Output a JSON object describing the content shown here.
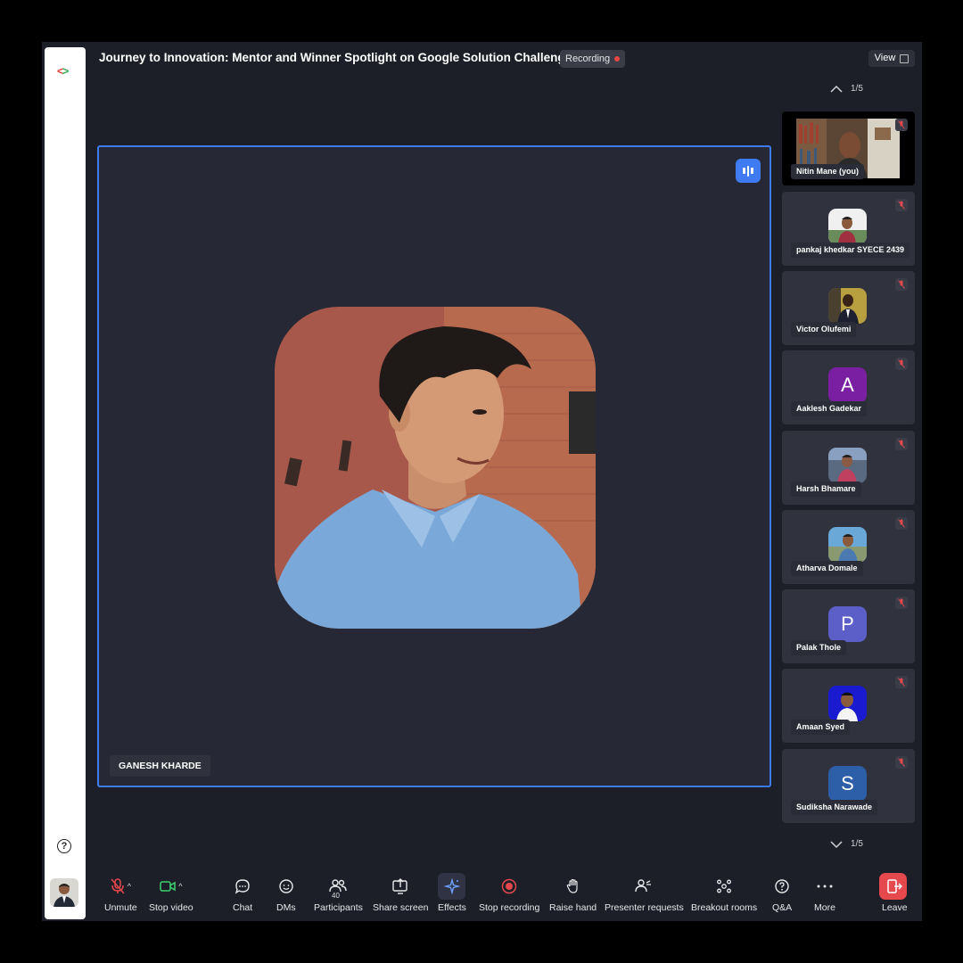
{
  "meeting": {
    "title": "Journey to Innovation: Mentor and Winner Spotlight on Google Solution Challenge",
    "recording_badge": "Recording",
    "view_label": "View",
    "page_top": "1/5",
    "page_bottom": "1/5"
  },
  "stage": {
    "speaker_name": "GANESH KHARDE"
  },
  "participants": [
    {
      "name": "Nitin Mane (you)",
      "type": "video"
    },
    {
      "name": "pankaj khedkar SYECE 2439",
      "type": "photo"
    },
    {
      "name": "Victor Olufemi",
      "type": "photo"
    },
    {
      "name": "Aaklesh Gadekar",
      "type": "letter",
      "letter": "A",
      "color": "#7b1fa2"
    },
    {
      "name": "Harsh Bhamare",
      "type": "photo"
    },
    {
      "name": "Atharva Domale",
      "type": "photo"
    },
    {
      "name": "Palak Thole",
      "type": "letter",
      "letter": "P",
      "color": "#5b5fc7"
    },
    {
      "name": "Amaan Syed",
      "type": "photo"
    },
    {
      "name": "Sudiksha Narawade",
      "type": "letter",
      "letter": "S",
      "color": "#2c5fa8"
    }
  ],
  "toolbar": {
    "unmute": "Unmute",
    "stop_video": "Stop video",
    "chat": "Chat",
    "dms": "DMs",
    "participants": "Participants",
    "participants_count": "40",
    "share_screen": "Share screen",
    "effects": "Effects",
    "stop_recording": "Stop recording",
    "raise_hand": "Raise hand",
    "presenter_requests": "Presenter requests",
    "breakout_rooms": "Breakout rooms",
    "qa": "Q&A",
    "more": "More",
    "leave": "Leave"
  },
  "colors": {
    "accent": "#3c7cf0",
    "recording": "#e84545",
    "leave": "#e5484d"
  }
}
